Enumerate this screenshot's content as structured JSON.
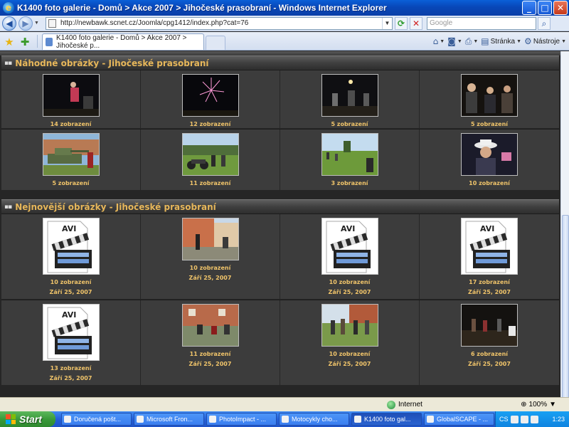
{
  "window": {
    "title": "K1400 foto galerie - Domů > Akce 2007 > Jihočeské prasobraní - Windows Internet Explorer",
    "min": "_",
    "max": "□",
    "close": "✕"
  },
  "address": {
    "url": "http://newbawk.scnet.cz/Joomla/cpg1412/index.php?cat=76",
    "search_placeholder": "Google"
  },
  "tabbar": {
    "tab_title": "K1400 foto galerie - Domů > Akce 2007 > Jihočeské p...",
    "page_menu": "Stránka",
    "tools_menu": "Nástroje"
  },
  "sections": {
    "random": {
      "title": "Náhodné obrázky - Jihočeské prasobraní",
      "items": [
        {
          "views": "14 zobrazení"
        },
        {
          "views": "12 zobrazení"
        },
        {
          "views": "5 zobrazení"
        },
        {
          "views": "5 zobrazení"
        },
        {
          "views": "5 zobrazení"
        },
        {
          "views": "11 zobrazení"
        },
        {
          "views": "3 zobrazení"
        },
        {
          "views": "10 zobrazení"
        }
      ]
    },
    "latest": {
      "title": "Nejnovější obrázky - Jihočeské prasobraní",
      "avi_label": "AVI",
      "items": [
        {
          "views": "10 zobrazení",
          "date": "Září 25, 2007"
        },
        {
          "views": "10 zobrazení",
          "date": "Září 25, 2007"
        },
        {
          "views": "10 zobrazení",
          "date": "Září 25, 2007"
        },
        {
          "views": "17 zobrazení",
          "date": "Září 25, 2007"
        },
        {
          "views": "13 zobrazení",
          "date": "Září 25, 2007"
        },
        {
          "views": "11 zobrazení",
          "date": "Září 25, 2007"
        },
        {
          "views": "10 zobrazení",
          "date": "Září 25, 2007"
        },
        {
          "views": "6 zobrazení",
          "date": "Září 25, 2007"
        }
      ]
    }
  },
  "statusbar": {
    "zone": "Internet",
    "zoom": "100%"
  },
  "taskbar": {
    "start": "Start",
    "tasks": [
      "Doručená pošt...",
      "Microsoft Fron...",
      "PhotoImpact - ...",
      "Motocykly cho...",
      "K1400 foto gal...",
      "GlobalSCAPE - ..."
    ],
    "tray_lang": "CS",
    "clock": "1:23"
  }
}
